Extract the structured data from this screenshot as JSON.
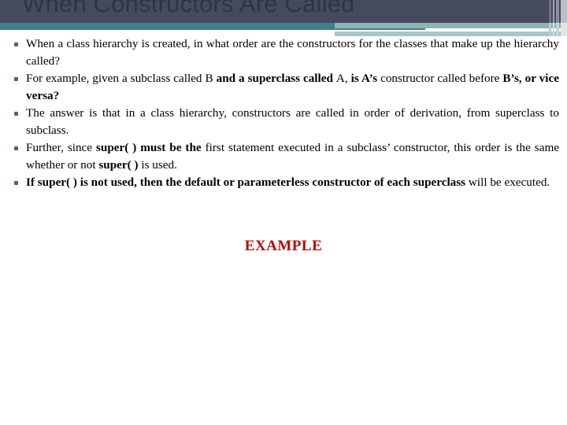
{
  "slide": {
    "title": "When Constructors Are Called",
    "theme": {
      "header_dark": "#464a5e",
      "header_teal": "#3f8189",
      "header_light_teal": "#8fb2b6",
      "bullet_color": "#7b4b7e",
      "accent_red": "#c00000",
      "body_text": "#000000",
      "background": "#ffffff"
    }
  },
  "bullets": [
    {
      "id": "bullet-1",
      "runs": [
        {
          "text": "When a class hierarchy is created, in what order are the constructors for the classes that make up the hierarchy called?",
          "bold": false
        }
      ]
    },
    {
      "id": "bullet-2",
      "runs": [
        {
          "text": "For example, given a subclass called B ",
          "bold": false
        },
        {
          "text": "and a superclass called ",
          "bold": true
        },
        {
          "text": "A, ",
          "bold": false
        },
        {
          "text": "is A’s ",
          "bold": true
        },
        {
          "text": "constructor called before ",
          "bold": false
        },
        {
          "text": "B’s, or vice versa?",
          "bold": true
        }
      ]
    },
    {
      "id": "bullet-3",
      "runs": [
        {
          "text": "The answer is that in a class hierarchy, constructors are called in order of derivation, from superclass to subclass.",
          "bold": false
        }
      ]
    },
    {
      "id": "bullet-4",
      "runs": [
        {
          "text": "Further, since ",
          "bold": false
        },
        {
          "text": "super( ) must be the ",
          "bold": true
        },
        {
          "text": "first statement executed in a subclass’ constructor, this order is the same whether or not ",
          "bold": false
        },
        {
          "text": "super( )",
          "bold": true
        },
        {
          "text": " is used.",
          "bold": false
        }
      ]
    },
    {
      "id": "bullet-5",
      "runs": [
        {
          "text": "If super( ) is not used, then the default or parameterless constructor of each superclass",
          "bold": true
        },
        {
          "text": " will be executed.",
          "bold": false
        }
      ]
    }
  ],
  "example": {
    "label": "EXAMPLE"
  }
}
